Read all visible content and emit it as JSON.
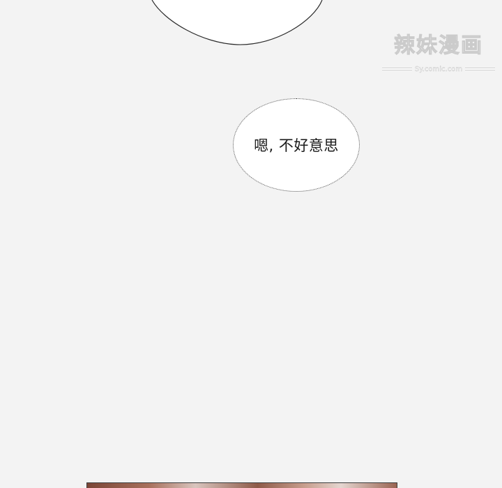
{
  "speech": {
    "text": "嗯, 不好意思"
  },
  "watermark": {
    "main": "辣妹漫画",
    "sub": "Sy.comic.com"
  },
  "colors": {
    "background": "#f3f3f3",
    "bubble_fill": "#ffffff",
    "bubble_outline": "#4a4a4a",
    "text": "#1a1a1a"
  }
}
